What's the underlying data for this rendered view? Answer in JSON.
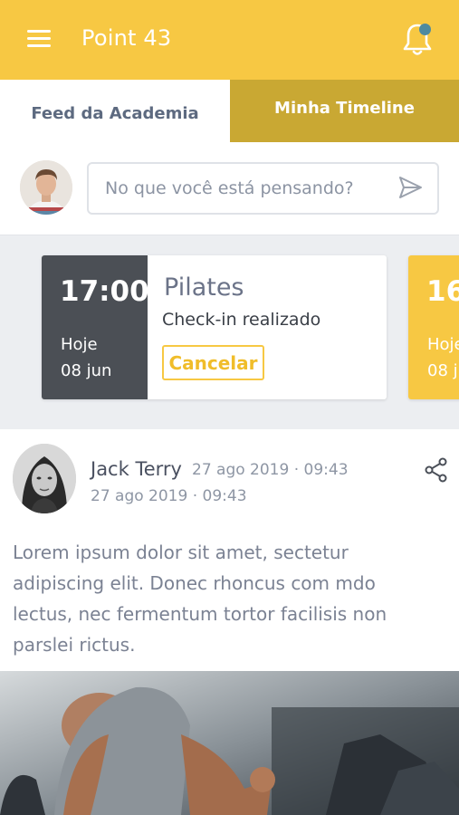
{
  "header": {
    "title": "Point 43",
    "menu_icon": "hamburger-menu-icon",
    "notification_icon": "bell-icon",
    "notification_dot_color": "#4e8a9f",
    "brand_color": "#f7c843"
  },
  "tabs": [
    {
      "label": "Feed da Academia",
      "active": true
    },
    {
      "label": "Minha Timeline",
      "active": false
    }
  ],
  "composer": {
    "placeholder": "No que você está pensando?",
    "send_icon": "send-icon"
  },
  "classes": [
    {
      "time": "17:00",
      "day": "Hoje",
      "date": "08 jun",
      "name": "Pilates",
      "status": "Check-in realizado",
      "action": "Cancelar"
    },
    {
      "time": "16:",
      "day": "Hoje",
      "date": "08 ju"
    }
  ],
  "post": {
    "author": "Jack Terry",
    "time_inline": "27 ago 2019 · 09:43",
    "time": "27 ago 2019 · 09:43",
    "body": "Lorem ipsum dolor sit amet, sectetur adipiscing elit. Donec rhoncus com mdo lectus, nec fermentum tortor facilisis non parslei rictus.",
    "share_icon": "share-icon"
  }
}
